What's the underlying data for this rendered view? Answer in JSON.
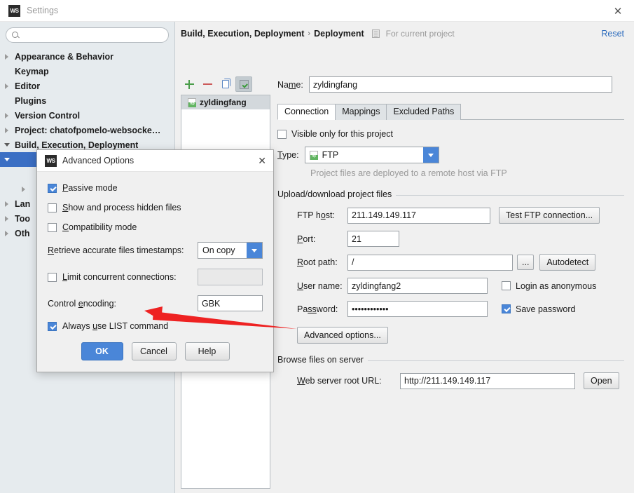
{
  "window": {
    "title": "Settings",
    "app_icon": "webstorm-logo-icon",
    "close_label": "✕"
  },
  "sidebar": {
    "search": {
      "value": "",
      "placeholder": ""
    },
    "items": [
      {
        "label": "Appearance & Behavior",
        "twisty": "right",
        "indent": 0,
        "selected": false
      },
      {
        "label": "Keymap",
        "twisty": "none",
        "indent": 0,
        "selected": false
      },
      {
        "label": "Editor",
        "twisty": "right",
        "indent": 0,
        "selected": false
      },
      {
        "label": "Plugins",
        "twisty": "none",
        "indent": 0,
        "selected": false
      },
      {
        "label": "Version Control",
        "twisty": "right",
        "indent": 0,
        "selected": false
      },
      {
        "label": "Project: chatofpomelo-websocke…",
        "twisty": "right",
        "indent": 0,
        "selected": false
      },
      {
        "label": "Build, Execution, Deployment",
        "twisty": "down",
        "indent": 0,
        "selected": false
      },
      {
        "label": "",
        "twisty": "down",
        "indent": 0,
        "selected": true
      },
      {
        "label": "",
        "twisty": "none",
        "indent": 2,
        "selected": false
      },
      {
        "label": "",
        "twisty": "right",
        "indent": 2,
        "selected": false
      },
      {
        "label": "Lan",
        "twisty": "right",
        "indent": 0,
        "selected": false
      },
      {
        "label": "Too",
        "twisty": "right",
        "indent": 0,
        "selected": false
      },
      {
        "label": "Oth",
        "twisty": "right",
        "indent": 0,
        "selected": false
      }
    ]
  },
  "breadcrumb": {
    "part1": "Build, Execution, Deployment",
    "separator": "›",
    "part2": "Deployment",
    "scope_note": "For current project",
    "reset_label": "Reset"
  },
  "server_panel": {
    "toolbar": {
      "add": "+",
      "remove": "−",
      "copy": "copy-icon",
      "default": "set-default-icon"
    },
    "items": [
      {
        "name": "zyldingfang",
        "icon": "ftp-icon",
        "selected": true
      }
    ]
  },
  "form": {
    "name_label": "Name:",
    "name_value": "zyldingfang",
    "tabs": [
      {
        "label": "Connection",
        "active": true
      },
      {
        "label": "Mappings",
        "active": false
      },
      {
        "label": "Excluded Paths",
        "active": false
      }
    ],
    "visible_only": {
      "label": "Visible only for this project",
      "checked": false
    },
    "type_label": "Type:",
    "type_value": "FTP",
    "type_description": "Project files are deployed to a remote host via FTP",
    "upload_group": {
      "title": "Upload/download project files",
      "ftp_host_label": "FTP host:",
      "ftp_host_value": "211.149.149.117",
      "test_button": "Test FTP connection...",
      "port_label": "Port:",
      "port_value": "21",
      "root_path_label": "Root path:",
      "root_path_value": "/",
      "browse_button": "...",
      "autodetect_button": "Autodetect",
      "user_label": "User name:",
      "user_value": "zyldingfang2",
      "anonymous": {
        "label": "Login as anonymous",
        "checked": false
      },
      "password_label": "Password:",
      "password_value": "••••••••••••",
      "save_password": {
        "label": "Save password",
        "checked": true
      },
      "advanced_button": "Advanced options..."
    },
    "browse_group": {
      "title": "Browse files on server",
      "url_label": "Web server root URL:",
      "url_value": "http://211.149.149.117",
      "open_button": "Open"
    }
  },
  "dialog": {
    "title": "Advanced Options",
    "icon": "webstorm-logo-icon",
    "close_label": "✕",
    "passive_mode": {
      "label": "Passive mode",
      "checked": true
    },
    "hidden_files": {
      "label": "Show and process hidden files",
      "checked": false
    },
    "compatibility_mode": {
      "label": "Compatibility mode",
      "checked": false
    },
    "timestamps_label": "Retrieve accurate files timestamps:",
    "timestamps_value": "On copy",
    "limit_connections": {
      "label": "Limit concurrent connections:",
      "checked": false,
      "value": ""
    },
    "control_encoding_label": "Control encoding:",
    "control_encoding_value": "GBK",
    "list_command": {
      "label": "Always use LIST command",
      "checked": true
    },
    "buttons": {
      "ok": "OK",
      "cancel": "Cancel",
      "help": "Help"
    }
  },
  "annotation": {
    "arrow_color": "#ee2222",
    "target": "always-use-list-command-checkbox"
  },
  "colors": {
    "accent_blue": "#4a86d8",
    "selection_blue": "#3b6fc4",
    "link_blue": "#2b6bbd",
    "panel_bg": "#f0f0f0",
    "sidebar_bg": "#e6ebee"
  }
}
